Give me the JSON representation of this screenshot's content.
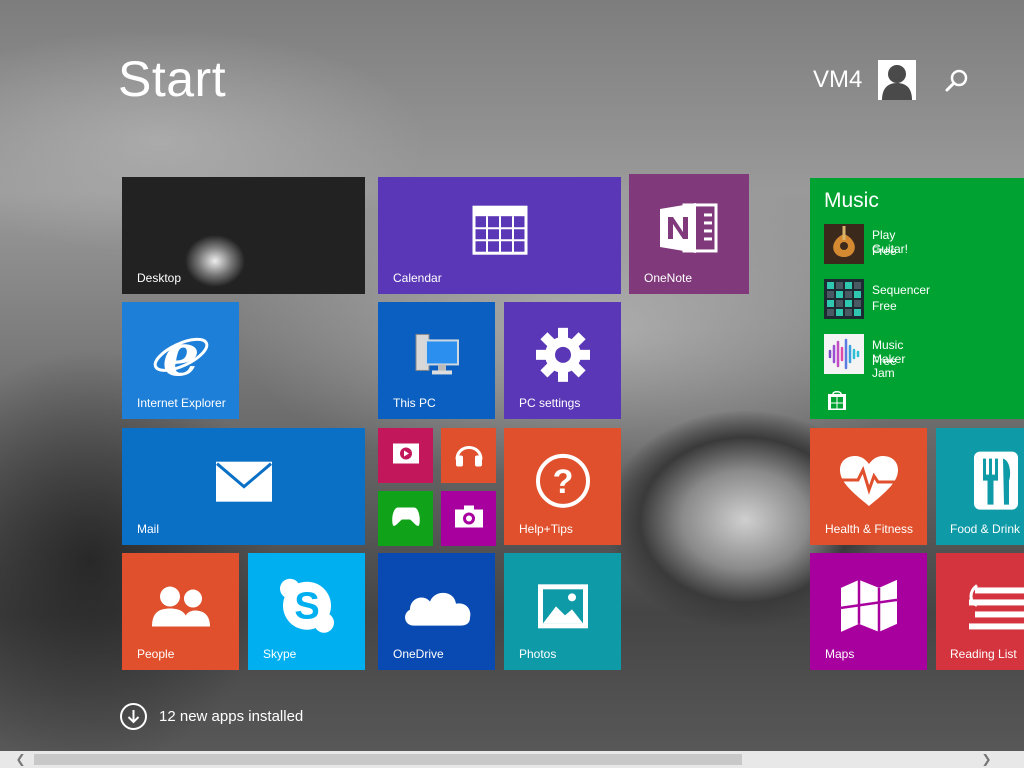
{
  "header": {
    "title": "Start",
    "user_name": "VM4"
  },
  "tiles": {
    "desktop": "Desktop",
    "calendar": "Calendar",
    "onenote": "OneNote",
    "internet_explorer": "Internet Explorer",
    "this_pc": "This PC",
    "pc_settings": "PC settings",
    "mail": "Mail",
    "help_tips": "Help+Tips",
    "people": "People",
    "skype": "Skype",
    "onedrive": "OneDrive",
    "photos": "Photos",
    "health_fitness": "Health & Fitness",
    "food_drink": "Food & Drink",
    "maps": "Maps",
    "reading_list": "Reading List"
  },
  "music": {
    "title": "Music",
    "apps": [
      {
        "name": "Play Guitar!",
        "price": "Free"
      },
      {
        "name": "Sequencer",
        "price": "Free"
      },
      {
        "name": "Music Maker Jam",
        "price": "Free"
      }
    ]
  },
  "notification": {
    "text": "12 new apps installed"
  },
  "colors": {
    "purple": "#5a37b6",
    "onenote": "#80397b",
    "blue": "#1e7fd8",
    "mail": "#0a70c6",
    "orange": "#e0502c",
    "skype": "#00aff0",
    "onedrive": "#094ab2",
    "teal": "#0e9aa7",
    "green": "#00a331",
    "magenta": "#a8009e",
    "red": "#d3343e"
  }
}
